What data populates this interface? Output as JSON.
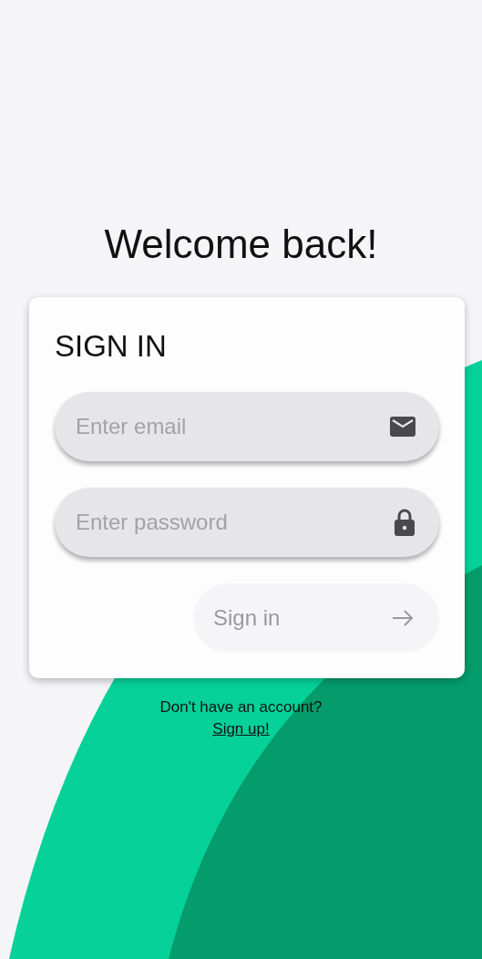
{
  "title": "Welcome back!",
  "card": {
    "heading": "SIGN IN",
    "fields": [
      {
        "kind": "email",
        "placeholder": "Enter email"
      },
      {
        "kind": "password",
        "placeholder": "Enter password"
      }
    ],
    "submit": {
      "label": "Sign in",
      "disabled": true
    }
  },
  "footer": {
    "prompt": "Don't have an account?",
    "link": "Sign up!"
  }
}
